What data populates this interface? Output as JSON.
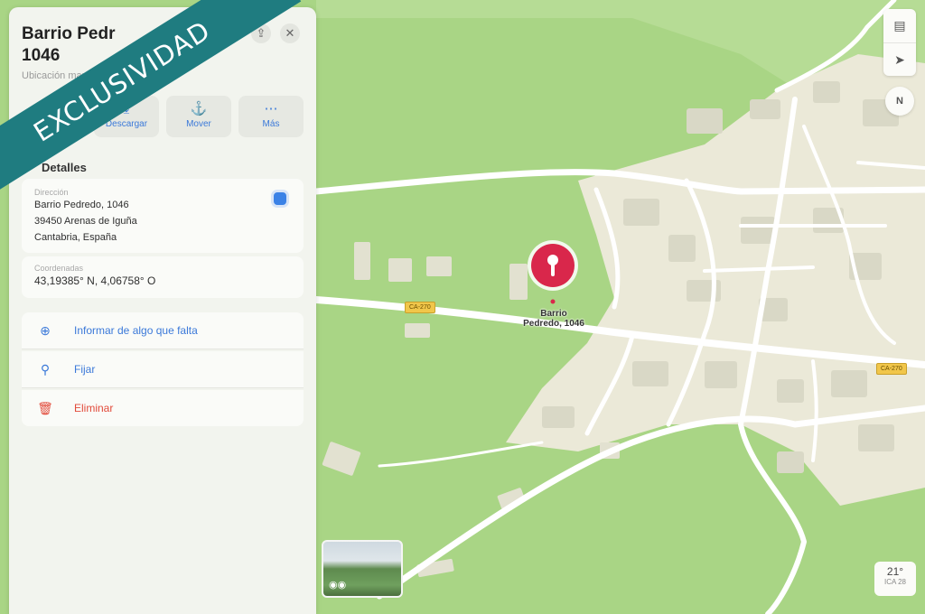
{
  "place": {
    "title": "Barrio Pedredo, 1046",
    "title_visible": "Barrio Pedr\n1046",
    "subtitle": "Ubicación marcada"
  },
  "header_buttons": {
    "share_icon": "share-icon",
    "close_icon": "close-icon"
  },
  "actions": [
    {
      "label": "Descargar",
      "icon": "download-icon"
    },
    {
      "label": "Mover",
      "icon": "move-pin-icon"
    },
    {
      "label": "Más",
      "icon": "more-icon"
    }
  ],
  "details": {
    "section_label": "Detalles",
    "address_label": "Dirección",
    "address_lines": [
      "Barrio Pedredo, 1046",
      "39450 Arenas de Iguña",
      "Cantabria, España"
    ],
    "coords_label": "Coordenadas",
    "coords_value": "43,19385° N, 4,06758° O"
  },
  "list_actions": [
    {
      "label": "Informar de algo que falta",
      "color": "#3b79d9",
      "icon": "report-icon"
    },
    {
      "label": "Fijar",
      "color": "#3b79d9",
      "icon": "pin-icon"
    },
    {
      "label": "Eliminar",
      "color": "#e24b3b",
      "icon": "trash-icon"
    }
  ],
  "map": {
    "pin_label": "Barrio\nPedredo, 1046",
    "road_tags": [
      "CA-270",
      "CA-270"
    ],
    "compass": "N",
    "weather": {
      "temp": "21°",
      "aqi": "ICA 28"
    }
  },
  "banner": {
    "text": "EXCLUSIVIDAD",
    "color": "#1f7c80"
  },
  "colors": {
    "map_green": "#a9d585",
    "map_town": "#ebe9d8",
    "pin_red": "#d9274b"
  }
}
